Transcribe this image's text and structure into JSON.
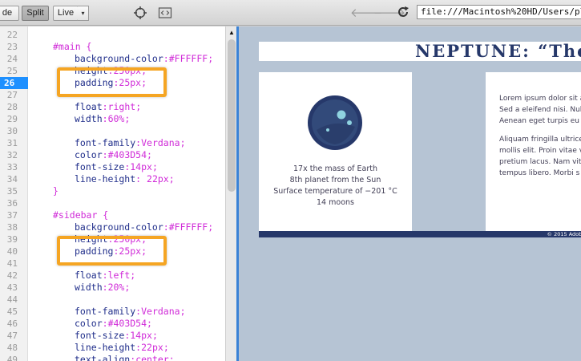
{
  "toolbar": {
    "code_label": "de",
    "split_label": "Split",
    "live_label": "Live",
    "live_caret": "▾",
    "inspect_icon": "crosshair-icon",
    "code_nav_icon": "code-brackets-icon",
    "back_icon": "back-arrow-icon",
    "forward_icon": "forward-arrow-icon",
    "refresh_icon": "refresh-icon",
    "url": "file:///Macintosh%20HD/Users/plant/Dro"
  },
  "editor": {
    "current_line": 26,
    "lines": [
      {
        "no": "22",
        "sel": "",
        "prop": "",
        "val": ""
      },
      {
        "no": "23",
        "sel": "#main {",
        "prop": "",
        "val": ""
      },
      {
        "no": "24",
        "sel": "",
        "prop": "background-color",
        "val": "#FFFFFF"
      },
      {
        "no": "25",
        "sel": "",
        "prop": "height",
        "val": "250px"
      },
      {
        "no": "26",
        "sel": "",
        "prop": "padding",
        "val": "25px"
      },
      {
        "no": "27",
        "sel": "",
        "prop": "",
        "val": ""
      },
      {
        "no": "28",
        "sel": "",
        "prop": "float",
        "val": "right"
      },
      {
        "no": "29",
        "sel": "",
        "prop": "width",
        "val": "60%"
      },
      {
        "no": "30",
        "sel": "",
        "prop": "",
        "val": ""
      },
      {
        "no": "31",
        "sel": "",
        "prop": "font-family",
        "val": "Verdana"
      },
      {
        "no": "32",
        "sel": "",
        "prop": "color",
        "val": "#403D54"
      },
      {
        "no": "33",
        "sel": "",
        "prop": "font-size",
        "val": "14px"
      },
      {
        "no": "34",
        "sel": "",
        "prop": "line-height",
        "val": " 22px"
      },
      {
        "no": "35",
        "sel": "}",
        "prop": "",
        "val": ""
      },
      {
        "no": "36",
        "sel": "",
        "prop": "",
        "val": ""
      },
      {
        "no": "37",
        "sel": "#sidebar {",
        "prop": "",
        "val": ""
      },
      {
        "no": "38",
        "sel": "",
        "prop": "background-color",
        "val": "#FFFFFF"
      },
      {
        "no": "39",
        "sel": "",
        "prop": "height",
        "val": "250px"
      },
      {
        "no": "40",
        "sel": "",
        "prop": "padding",
        "val": "25px"
      },
      {
        "no": "41",
        "sel": "",
        "prop": "",
        "val": ""
      },
      {
        "no": "42",
        "sel": "",
        "prop": "float",
        "val": "left"
      },
      {
        "no": "43",
        "sel": "",
        "prop": "width",
        "val": "20%"
      },
      {
        "no": "44",
        "sel": "",
        "prop": "",
        "val": ""
      },
      {
        "no": "45",
        "sel": "",
        "prop": "font-family",
        "val": "Verdana"
      },
      {
        "no": "46",
        "sel": "",
        "prop": "color",
        "val": "#403D54"
      },
      {
        "no": "47",
        "sel": "",
        "prop": "font-size",
        "val": "14px"
      },
      {
        "no": "48",
        "sel": "",
        "prop": "line-height",
        "val": "22px"
      },
      {
        "no": "49",
        "sel": "",
        "prop": "text-align",
        "val": "center"
      }
    ]
  },
  "preview": {
    "title": "NEPTUNE: “The",
    "facts": [
      "17x the mass of Earth",
      "8th planet from the Sun",
      "Surface temperature of −201 °C",
      "14 moons"
    ],
    "para1": [
      "Lorem ipsum dolor sit a",
      "Sed a eleifend nisi. Nul",
      "Aenean eget turpis eu"
    ],
    "para2": [
      "Aliquam fringilla ultrice",
      "mollis elit. Proin vitae v",
      "pretium lacus. Nam vit",
      "tempus libero. Morbi s"
    ],
    "footer": "© 2015 Adobe St"
  },
  "colors": {
    "accent_highlight": "#f5a523",
    "current_line": "#1e90ff",
    "code_property": "#1f2d8a",
    "code_value": "#d02ad8",
    "preview_bg": "#b6c4d4",
    "preview_navy": "#26386a"
  }
}
